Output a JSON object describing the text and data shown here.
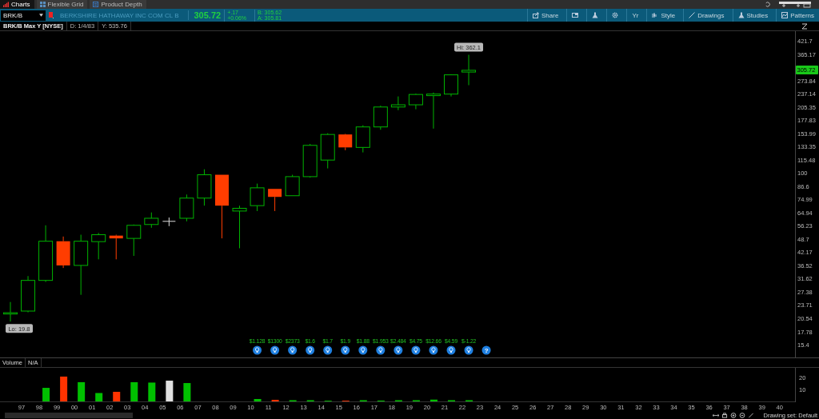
{
  "tabs": [
    {
      "label": "Charts",
      "selected": true,
      "kind": "chart"
    },
    {
      "label": "Flexible Grid",
      "selected": false,
      "kind": "grid"
    },
    {
      "label": "Product Depth",
      "selected": false,
      "kind": "depth"
    }
  ],
  "symbol_bar": {
    "symbol": "BRK/B",
    "description": "BERKSHIRE HATHAWAY INC COM CL B",
    "last": "305.72",
    "change": "+.17",
    "change_percent": "+0.06%",
    "bid": "B: 305.62",
    "ask": "A: 305.81"
  },
  "toolbar": [
    {
      "label": "Share",
      "kind": "share"
    },
    {
      "kind": "window"
    },
    {
      "kind": "flask"
    },
    {
      "kind": "gear"
    },
    {
      "label": "Yr",
      "kind": "text"
    },
    {
      "label": "Style",
      "kind": "style"
    },
    {
      "label": "Drawings",
      "kind": "pencil"
    },
    {
      "label": "Studies",
      "kind": "flask"
    },
    {
      "label": "Patterns",
      "kind": "patterns"
    }
  ],
  "info": [
    "BRK/B Max Y [NYSE]",
    "D: 1/4/83",
    "Y: 535.76"
  ],
  "price_chart": {
    "axis_labels": [
      "421.7",
      "365.17",
      "273.84",
      "237.14",
      "205.35",
      "177.83",
      "153.99",
      "133.35",
      "115.48",
      "100",
      "86.6",
      "74.99",
      "64.94",
      "56.23",
      "48.7",
      "42.17",
      "36.52",
      "31.62",
      "27.38",
      "23.71",
      "20.54",
      "17.78",
      "15.4"
    ],
    "high_label": "Hi: 362.1",
    "low_label": "Lo: 19.8",
    "last_price_tag": "305.72",
    "events": [
      {
        "kind": "earnings",
        "label": "$1.128"
      },
      {
        "kind": "earnings",
        "label": "$1300"
      },
      {
        "kind": "earnings",
        "label": "$2373"
      },
      {
        "kind": "earnings",
        "label": "$1.6"
      },
      {
        "kind": "earnings",
        "label": "$1.7"
      },
      {
        "kind": "earnings",
        "label": "$1.9"
      },
      {
        "kind": "earnings",
        "label": "$1.88"
      },
      {
        "kind": "earnings",
        "label": "$1.953"
      },
      {
        "kind": "earnings",
        "label": "$2.484"
      },
      {
        "kind": "earnings",
        "label": "$4.75"
      },
      {
        "kind": "earnings",
        "label": "$12.66"
      },
      {
        "kind": "earnings",
        "label": "$4.59"
      },
      {
        "kind": "earnings",
        "label": "$-1.22"
      },
      {
        "kind": "unknown",
        "label": "?"
      }
    ]
  },
  "volume": {
    "title": "Volume",
    "reading": "N/A",
    "axis_labels": [
      "20",
      "10"
    ]
  },
  "x_axis": [
    "97",
    "98",
    "99",
    "00",
    "01",
    "02",
    "03",
    "04",
    "05",
    "06",
    "07",
    "08",
    "09",
    "10",
    "11",
    "12",
    "13",
    "14",
    "15",
    "16",
    "17",
    "18",
    "19",
    "20",
    "21",
    "22",
    "23",
    "24",
    "25",
    "26",
    "27",
    "28",
    "29",
    "30",
    "31",
    "32",
    "33",
    "34",
    "35",
    "36",
    "37",
    "38",
    "39",
    "40"
  ],
  "status": "Drawing set: Default"
}
